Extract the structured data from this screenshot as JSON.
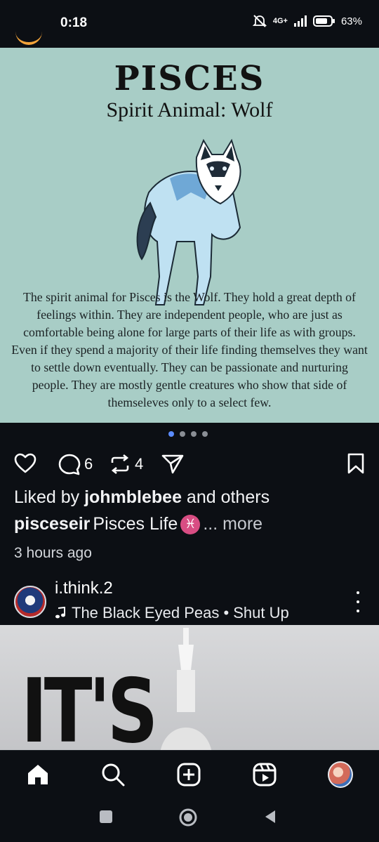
{
  "status_bar": {
    "time": "0:18",
    "network": "4G+",
    "battery": "63%"
  },
  "post": {
    "image": {
      "title": "PISCES",
      "subtitle": "Spirit Animal: Wolf",
      "paragraph": "The spirit animal for Pisces is the Wolf. They hold a great depth of feelings within. They are independent people, who are just as comfortable being alone for large parts of their life as with groups. Even if they spend a majority of their life finding themselves they want to settle down eventually. They can be passionate and nurturing people. They are mostly gentle creatures who show that side of themseleves only to a select few."
    },
    "carousel": {
      "count": 4,
      "active_index": 0
    },
    "actions": {
      "comment_count": "6",
      "repost_count": "4"
    },
    "likes": {
      "prefix": "Liked by ",
      "user": "johmblebee",
      "suffix": " and others"
    },
    "caption": {
      "username": "pisceseir",
      "text": " Pisces Life ",
      "emoji": "♓",
      "more": "... more"
    },
    "timestamp": "3 hours ago"
  },
  "next_post": {
    "username": "i.think.2",
    "audio_icon": "music-note-icon",
    "audio": "The Black Eyed Peas • Shut Up",
    "image_text": "IT'S THE"
  },
  "bottom_nav": {
    "items": [
      "home-icon",
      "search-icon",
      "create-icon",
      "reels-icon",
      "profile-avatar"
    ]
  },
  "colors": {
    "background": "#0c0f14",
    "post_image_bg": "#a8cdc6",
    "active_dot": "#5b8cff",
    "pisces_badge": "#d84d83"
  }
}
